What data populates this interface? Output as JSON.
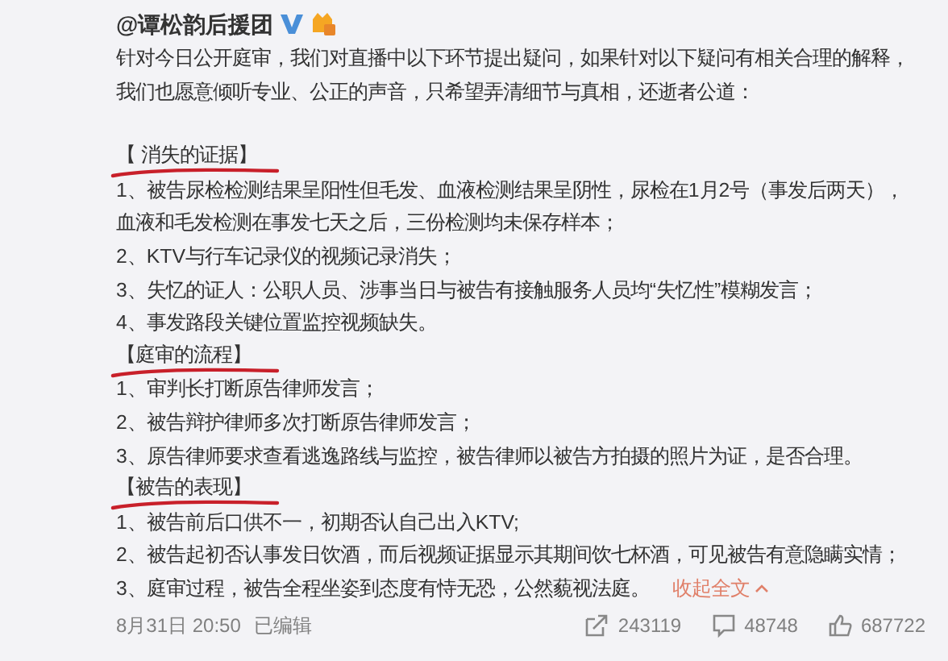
{
  "author": {
    "name": "@谭松韵后援团",
    "verified": true,
    "vip": true
  },
  "intro": {
    "lines": [
      "针对今日公开庭审，我们对直播中以下环节提出疑问，如果针对以下疑问有相关合理的解释，",
      "我们也愿意倾听专业、公正的声音，只希望弄清细节与真相，还逝者公道："
    ]
  },
  "sections": [
    {
      "title": "【 消失的证据】",
      "items": [
        {
          "lines": [
            "1、被告尿检检测结果呈阳性但毛发、血液检测结果呈阴性，尿检在1月2号（事发后两天），",
            "血液和毛发检测在事发七天之后，三份检测均未保存样本；"
          ]
        },
        {
          "lines": [
            "2、KTV与行车记录仪的视频记录消失；"
          ]
        },
        {
          "lines": [
            "3、失忆的证人：公职人员、涉事当日与被告有接触服务人员均“失忆性”模糊发言；"
          ]
        },
        {
          "lines": [
            "4、事发路段关键位置监控视频缺失。"
          ]
        }
      ]
    },
    {
      "title": "【庭审的流程】",
      "items": [
        {
          "lines": [
            "1、审判长打断原告律师发言；"
          ]
        },
        {
          "lines": [
            "2、被告辩护律师多次打断原告律师发言；"
          ]
        },
        {
          "lines": [
            "3、原告律师要求查看逃逸路线与监控，被告律师以被告方拍摄的照片为证，是否合理。"
          ]
        }
      ]
    },
    {
      "title": "【被告的表现】",
      "items": [
        {
          "lines": [
            "1、被告前后口供不一，初期否认自己出入KTV;"
          ]
        },
        {
          "lines": [
            "2、被告起初否认事发日饮酒，而后视频证据显示其期间饮七杯酒，可见被告有意隐瞒实情；"
          ]
        },
        {
          "lines": [
            "3、庭审过程，被告全程坐姿到态度有恃无恐，公然藐视法庭。"
          ]
        }
      ]
    }
  ],
  "collapse_link": "收起全文",
  "footer": {
    "time": "8月31日 20:50",
    "edited": "已编辑",
    "reposts": "243119",
    "comments": "48748",
    "likes": "687722"
  }
}
